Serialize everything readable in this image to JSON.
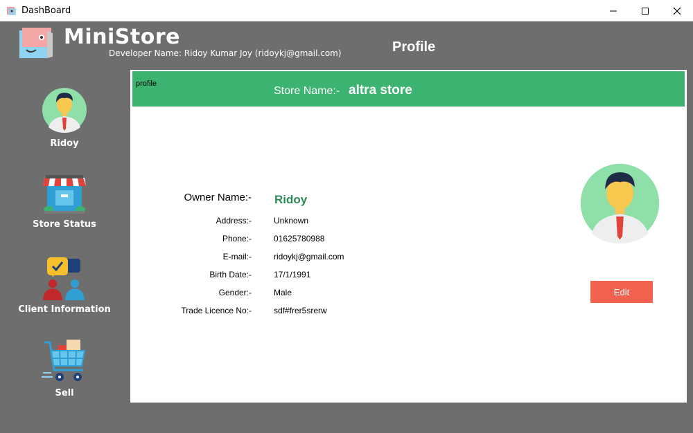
{
  "window": {
    "title": "DashBoard",
    "controls": {
      "minimize": "minimize-icon",
      "maximize": "maximize-icon",
      "close": "close-icon"
    }
  },
  "header": {
    "brand": "MiniStore",
    "developer": "Developer Name: Ridoy Kumar Joy (ridoykj@gmail.com)",
    "page_title": "Profile"
  },
  "sidebar": {
    "items": [
      {
        "label": "Ridoy",
        "icon": "user-avatar-icon"
      },
      {
        "label": "Store Status",
        "icon": "storefront-icon"
      },
      {
        "label": "Client Information",
        "icon": "clients-chat-icon"
      },
      {
        "label": "Sell",
        "icon": "shopping-cart-icon"
      }
    ]
  },
  "profile": {
    "tab_label": "profile",
    "store_name_label": "Store Name:-",
    "store_name": "altra store",
    "owner_label": "Owner Name:-",
    "owner_name": "Ridoy",
    "fields": [
      {
        "label": "Address:-",
        "value": "Unknown"
      },
      {
        "label": "Phone:-",
        "value": "01625780988"
      },
      {
        "label": "E-mail:-",
        "value": "ridoykj@gmail.com"
      },
      {
        "label": "Birth Date:-",
        "value": "17/1/1991"
      },
      {
        "label": "Gender:-",
        "value": "Male"
      },
      {
        "label": "Trade Licence No:-",
        "value": "sdf#frer5srerw"
      }
    ],
    "edit_label": "Edit"
  },
  "colors": {
    "background": "#6e6e6e",
    "banner": "#3cb371",
    "owner_name": "#2e8b57",
    "edit_button": "#f2624f"
  }
}
